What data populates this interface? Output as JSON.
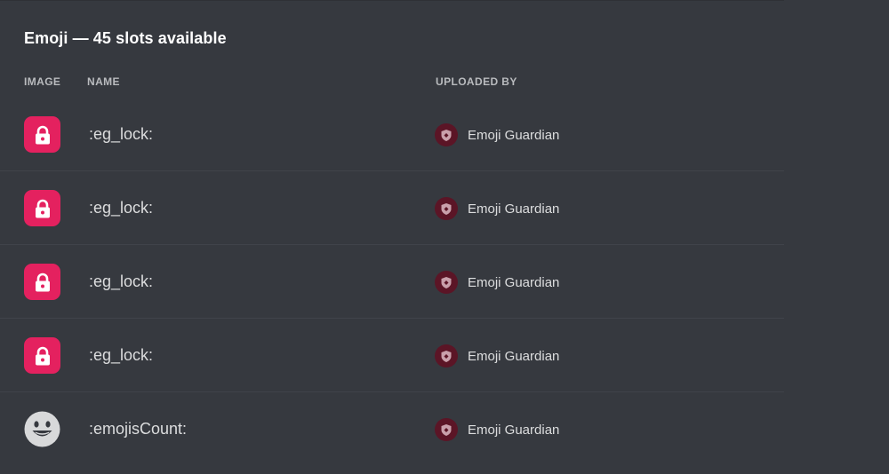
{
  "section": {
    "title": "Emoji — 45 slots available"
  },
  "columns": {
    "image": "IMAGE",
    "name": "NAME",
    "uploaded_by": "UPLOADED BY"
  },
  "emojis": [
    {
      "name": ":eg_lock:",
      "icon": "lock-icon",
      "uploaded_by": "Emoji Guardian"
    },
    {
      "name": ":eg_lock:",
      "icon": "lock-icon",
      "uploaded_by": "Emoji Guardian"
    },
    {
      "name": ":eg_lock:",
      "icon": "lock-icon",
      "uploaded_by": "Emoji Guardian"
    },
    {
      "name": ":eg_lock:",
      "icon": "lock-icon",
      "uploaded_by": "Emoji Guardian"
    },
    {
      "name": ":emojisCount:",
      "icon": "smiley-face-icon",
      "uploaded_by": "Emoji Guardian"
    }
  ],
  "colors": {
    "background": "#36393f",
    "lock_tile": "#e4215f",
    "avatar": "#5b1526"
  }
}
